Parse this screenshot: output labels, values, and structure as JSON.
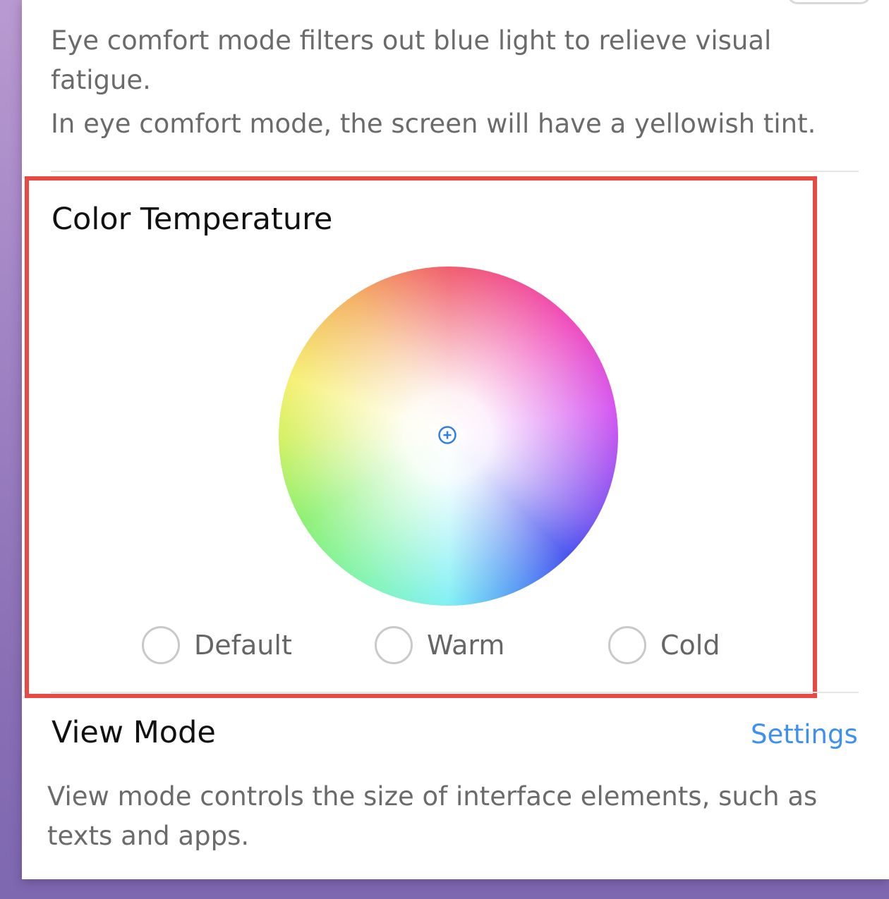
{
  "eye_comfort": {
    "description_line1": "Eye comfort mode filters out blue light to relieve visual fatigue.",
    "description_line2": "In eye comfort mode, the screen will have a yellowish tint."
  },
  "color_temperature": {
    "title": "Color Temperature",
    "options": [
      {
        "label": "Default",
        "selected": false
      },
      {
        "label": "Warm",
        "selected": false
      },
      {
        "label": "Cold",
        "selected": false
      }
    ],
    "highlight_color": "#e84a43"
  },
  "view_mode": {
    "title": "View Mode",
    "settings_link": "Settings",
    "description": "View mode controls the size of interface elements, such as texts and apps."
  },
  "colors": {
    "link": "#3f8ff0",
    "handle": "#2f7fe8"
  },
  "icons": {
    "wheel_handle": "crosshair-plus-icon"
  }
}
